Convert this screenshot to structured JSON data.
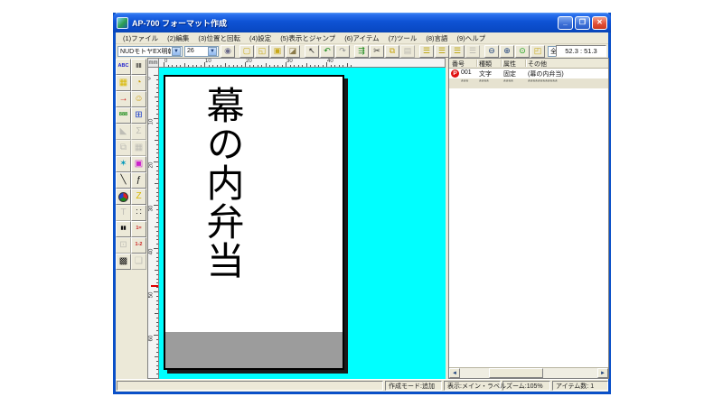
{
  "window": {
    "title": "AP-700 フォーマット作成"
  },
  "titlebar": {
    "minimize_glyph": "_",
    "restore_glyph": "❐",
    "close_glyph": "✕"
  },
  "menubar": {
    "items": [
      {
        "name": "file",
        "label": "(1)ファイル"
      },
      {
        "name": "edit",
        "label": "(2)編集"
      },
      {
        "name": "position-rotation",
        "label": "(3)位置と回転"
      },
      {
        "name": "settings",
        "label": "(4)設定"
      },
      {
        "name": "view-jump",
        "label": "(5)表示とジャンプ"
      },
      {
        "name": "item",
        "label": "(6)アイテム"
      },
      {
        "name": "tool",
        "label": "(7)ツール"
      },
      {
        "name": "language",
        "label": "(8)言語"
      },
      {
        "name": "help",
        "label": "(9)ヘルプ"
      }
    ]
  },
  "toolbar": {
    "font_select": "NUDモトヤEX明朝",
    "size_select": "26",
    "view_select": "全体表示",
    "coords": "52.3 : 51.3",
    "dropdown_glyph": "▼",
    "buttons": [
      {
        "name": "text-style-button",
        "glyph": "◉",
        "color": "#6a6a8a"
      },
      {
        "name": "new-button",
        "glyph": "▢",
        "color": "#c8a818",
        "gap": true
      },
      {
        "name": "open-button",
        "glyph": "◱",
        "color": "#c8a818"
      },
      {
        "name": "save-button",
        "glyph": "▣",
        "color": "#c8a818"
      },
      {
        "name": "import-button",
        "glyph": "◪",
        "color": "#8a7a4a"
      },
      {
        "name": "select-button",
        "glyph": "↖",
        "color": "#222222",
        "gap": true
      },
      {
        "name": "undo-button",
        "glyph": "↶",
        "color": "#188818"
      },
      {
        "name": "redo-button",
        "glyph": "↷",
        "color": "#909090"
      },
      {
        "name": "arrange-button",
        "glyph": "⇶",
        "color": "#188818",
        "gap": true
      },
      {
        "name": "cut-button",
        "glyph": "✂",
        "color": "#333333"
      },
      {
        "name": "copy-button",
        "glyph": "⧉",
        "color": "#c8a818"
      },
      {
        "name": "paste-button",
        "glyph": "▤",
        "color": "#909090",
        "disabled": true
      },
      {
        "name": "item-list-button",
        "glyph": "☰",
        "color": "#b8a000",
        "gap": true
      },
      {
        "name": "format-list-button",
        "glyph": "☰",
        "color": "#b8a000"
      },
      {
        "name": "layer-list-button",
        "glyph": "☰",
        "color": "#b8a000"
      },
      {
        "name": "history-list-button",
        "glyph": "☰",
        "color": "#909090",
        "disabled": true
      },
      {
        "name": "zoom-out-button",
        "glyph": "⊖",
        "color": "#1a3e7a",
        "gap": true
      },
      {
        "name": "zoom-in-button",
        "glyph": "⊕",
        "color": "#1a3e7a"
      },
      {
        "name": "hint-lamp-button",
        "glyph": "⊙",
        "color": "#18a018"
      },
      {
        "name": "open-format-button",
        "glyph": "◰",
        "color": "#c8a818"
      }
    ]
  },
  "sidebar": {
    "tools": [
      {
        "name": "text-tool",
        "glyph": "ABC",
        "color": "#2222cc",
        "small": true
      },
      {
        "name": "barcode-tool",
        "glyph": "||||",
        "color": "#111111",
        "small": true
      },
      {
        "name": "grid-tool",
        "glyph": "▦",
        "color": "#d8b800"
      },
      {
        "name": "clock-tool",
        "glyph": "◔",
        "color": "#c89800"
      },
      {
        "name": "arrow-tool",
        "glyph": "→",
        "color": "#cc1111"
      },
      {
        "name": "smiley-tool",
        "glyph": "☺",
        "color": "#c89800"
      },
      {
        "name": "counter-tool",
        "glyph": "888",
        "color": "#118811",
        "small": true
      },
      {
        "name": "calculator-tool",
        "glyph": "⊞",
        "color": "#2244cc"
      },
      {
        "name": "triangle-tool",
        "glyph": "◣",
        "color": "#9a9a9a",
        "disabled": true
      },
      {
        "name": "sigma-tool",
        "glyph": "Σ",
        "color": "#9a9a9a",
        "disabled": true
      },
      {
        "name": "pages-tool",
        "glyph": "⧉",
        "color": "#9a9a9a",
        "disabled": true
      },
      {
        "name": "table-tool",
        "glyph": "▦",
        "color": "#9a9a9a",
        "disabled": true
      },
      {
        "name": "effect-tool",
        "glyph": "✶",
        "color": "#0099bb"
      },
      {
        "name": "cassette-tool",
        "glyph": "▣",
        "color": "#cc22cc"
      },
      {
        "name": "line-tool",
        "glyph": "╲",
        "color": "#111111"
      },
      {
        "name": "function-tool",
        "glyph": "ƒ",
        "color": "#111111"
      },
      {
        "name": "pie-chart-tool",
        "type": "pie"
      },
      {
        "name": "polyline-tool",
        "glyph": "Z",
        "color": "#d8b800"
      },
      {
        "name": "text-frame-tool",
        "glyph": "T",
        "color": "#9a9a9a",
        "disabled": true
      },
      {
        "name": "matrix-tool",
        "glyph": "∷",
        "color": "#333333"
      },
      {
        "name": "barcode-image-tool",
        "glyph": "▮▮",
        "color": "#111111",
        "small": true
      },
      {
        "name": "numbered-list-tool",
        "glyph": "1=",
        "color": "#cc2222",
        "small": true
      },
      {
        "name": "frame-tool",
        "glyph": "⊡",
        "color": "#9a9a9a",
        "disabled": true
      },
      {
        "name": "sequence-tool",
        "glyph": "1-2",
        "color": "#cc2222",
        "small": true
      },
      {
        "name": "dither-tool",
        "glyph": "▩",
        "color": "#111111"
      },
      {
        "name": "page-flip-tool",
        "glyph": "❏",
        "color": "#9a9a9a",
        "disabled": true
      }
    ]
  },
  "canvas": {
    "background": "#00FFFF",
    "ruler_unit": "mm",
    "top_ruler_numbers": [
      "0",
      "10",
      "20",
      "30",
      "40"
    ],
    "left_ruler_numbers": [
      "0",
      "10",
      "20",
      "30",
      "40",
      "50",
      "60"
    ],
    "label_text": "幕の内弁当"
  },
  "right_panel": {
    "columns": {
      "num": "番号",
      "type": "種類",
      "attr": "属性",
      "other": "その他"
    },
    "rows": [
      {
        "badge": "P",
        "num": "001",
        "type": "文字",
        "attr": "固定",
        "other": "(幕の内弁当)"
      },
      {
        "num": "***",
        "type": "****",
        "attr": "****",
        "other": "************"
      }
    ],
    "scroll_left_glyph": "◄",
    "scroll_right_glyph": "►"
  },
  "statusbar": {
    "mode_label": "作成モード:追加",
    "view_label": "表示:メイン・ラベル",
    "zoom_label": "ズーム:105%",
    "items_label": "アイテム数:  1"
  }
}
